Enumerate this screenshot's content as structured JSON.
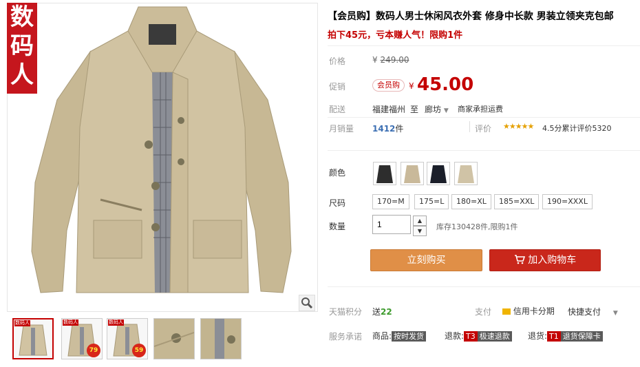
{
  "gallery": {
    "brand_tag": [
      "数",
      "码",
      "人"
    ],
    "thumbs": [
      {
        "tag": "数码人",
        "badge": ""
      },
      {
        "tag": "数码人",
        "badge": "79"
      },
      {
        "tag": "数码人",
        "badge": "59"
      },
      {
        "tag": "",
        "badge": ""
      },
      {
        "tag": "",
        "badge": ""
      }
    ]
  },
  "product": {
    "title": "【会员购】数码人男士休闲风衣外套 修身中长款 男装立领夹克包邮",
    "subtitle": "拍下45元，亏本赚人气！限购1件"
  },
  "price": {
    "label": "价格",
    "currency": "¥",
    "original": "249.00",
    "promo_label": "促销",
    "member_tag": "会员购",
    "promo_price": "45.00"
  },
  "shipping": {
    "label": "配送",
    "from": "福建福州",
    "to_word": "至",
    "to": "廊坊",
    "note": "商家承担运费"
  },
  "stats": {
    "sales_label": "月销量",
    "sales_value": "1412",
    "sales_unit": "件",
    "rating_label": "评价",
    "stars": "★★★★★",
    "rating_score": "4.5分",
    "rating_count_label": "累计评价",
    "rating_count": "5320"
  },
  "color": {
    "label": "颜色",
    "swatch_colors": [
      "#2d2d2d",
      "#c9b99a",
      "#1b1f2a",
      "#d0c3a6"
    ]
  },
  "size": {
    "label": "尺码",
    "options": [
      "170=M",
      "175=L",
      "180=XL",
      "185=XXL",
      "190=XXXL"
    ]
  },
  "quantity": {
    "label": "数量",
    "value": "1",
    "stock_note": "库存130428件,限购1件"
  },
  "buttons": {
    "buy_now": "立刻购买",
    "add_cart": "加入购物车"
  },
  "points": {
    "label": "天猫积分",
    "send": "送",
    "value": "22"
  },
  "payment": {
    "label": "支付",
    "credit": "信用卡分期",
    "express": "快捷支付"
  },
  "service": {
    "label": "服务承诺",
    "goods_label": "商品:",
    "goods_tag": "按时发货",
    "refund_label": "退款:",
    "refund_code": "T3",
    "refund_tag": "极速退款",
    "return_label": "退货:",
    "return_code": "T1",
    "return_tag": "退货保障卡"
  },
  "colors": {
    "accent_red": "#c40000",
    "buy_orange": "#e08f47",
    "cart_red": "#c9271b"
  }
}
